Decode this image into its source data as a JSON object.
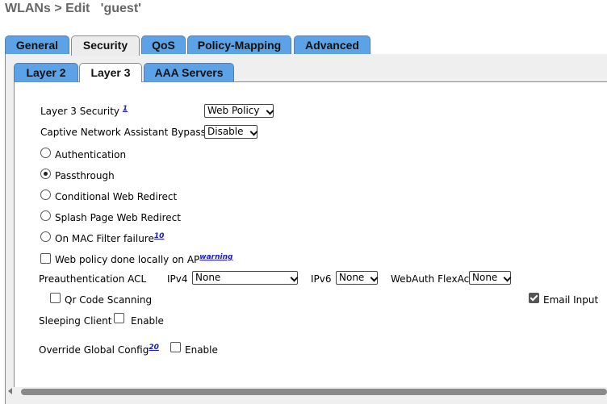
{
  "header": {
    "title": "WLANs > Edit   'guest'"
  },
  "tabs": [
    {
      "label": "General"
    },
    {
      "label": "Security"
    },
    {
      "label": "QoS"
    },
    {
      "label": "Policy-Mapping"
    },
    {
      "label": "Advanced"
    }
  ],
  "subtabs": [
    {
      "label": "Layer 2"
    },
    {
      "label": "Layer 3"
    },
    {
      "label": "AAA Servers"
    }
  ],
  "form": {
    "layer3_security": {
      "label": "Layer 3 Security",
      "footnote": "1",
      "value": "Web Policy"
    },
    "cna_bypass": {
      "label": "Captive Network Assistant Bypass",
      "value": "Disable"
    },
    "radios": [
      {
        "label": "Authentication",
        "selected": false
      },
      {
        "label": "Passthrough",
        "selected": true
      },
      {
        "label": "Conditional Web Redirect",
        "selected": false
      },
      {
        "label": "Splash Page Web Redirect",
        "selected": false
      },
      {
        "label": "On MAC Filter failure",
        "footnote": "10",
        "selected": false
      }
    ],
    "web_policy_local": {
      "label": "Web policy done locally on AP",
      "footnote": "warning",
      "checked": false
    },
    "preauth_acl": {
      "label": "Preauthentication ACL",
      "ipv4_label": "IPv4",
      "ipv4_value": "None",
      "ipv6_label": "IPv6",
      "ipv6_value": "None",
      "flexacl_label": "WebAuth FlexAcl",
      "flexacl_value": "None"
    },
    "qr_code": {
      "label": "Qr Code Scanning",
      "checked": false
    },
    "email_input": {
      "label": "Email Input",
      "checked": true
    },
    "sleeping_client": {
      "label": "Sleeping Client",
      "enable_label": "Enable",
      "checked": false
    },
    "override_global": {
      "label": "Override Global Config",
      "footnote": "20",
      "enable_label": "Enable",
      "checked": false
    }
  },
  "colors": {
    "tab_blue": "#5ba3e6",
    "panel_gray": "#efefef",
    "title_gray": "#666666",
    "link_blue": "#1a1acc"
  }
}
